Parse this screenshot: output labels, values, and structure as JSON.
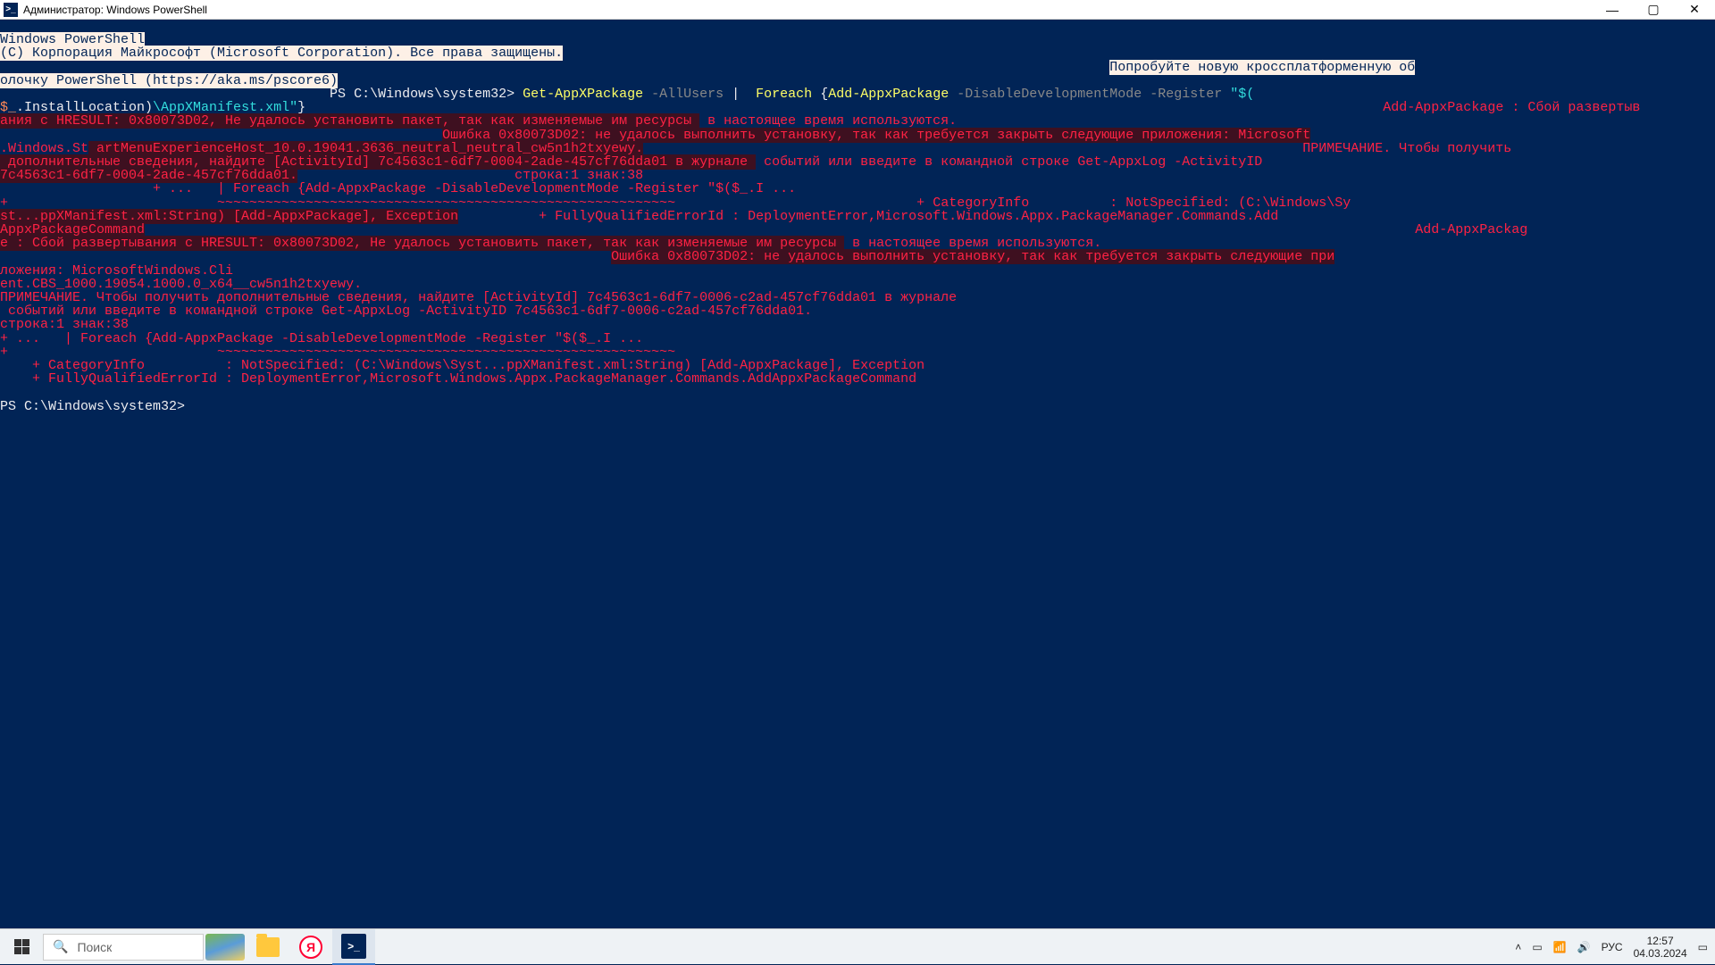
{
  "window": {
    "title": "Администратор: Windows PowerShell"
  },
  "terminal": {
    "l1": "Windows PowerShell",
    "l2": "(C) Корпорация Майкрософт (Microsoft Corporation). Все права защищены.",
    "l3": "Попробуйте новую кроссплатформенную об",
    "l4": "олочку PowerShell (https://aka.ms/pscore6)",
    "prompt1_pre": "                                         PS C:\\Windows\\system32> ",
    "cmd1_a": "Get-AppXPackage ",
    "cmd1_b": "-AllUsers ",
    "cmd1_c": "| ",
    "cmd1_d": " Foreach ",
    "cmd1_e": "{",
    "cmd1_f": "Add-AppxPackage ",
    "cmd1_g": "-DisableDevelopmentMode -Register ",
    "cmd1_h": "\"$(",
    "l5a": "$_",
    "l5b": ".InstallLocation)",
    "l5c": "\\AppXManifest.xml\"",
    "l5d": "}",
    "err_line_a": "Add-AppxPackage : Сбой развертыв",
    "err_hl_1": "ания с HRESULT: 0x80073D02, Не удалось установить пакет, так как изменяемые им ресурсы ",
    "err_1_tail": " в настоящее время используются.",
    "err_2_lead": "                                                       ",
    "err_hl_2": "Ошибка 0x80073D02: не удалось выполнить установку, так как требуется закрыть следующие приложения: Microsoft",
    "err_3a": ".Windows.St",
    "err_hl_3b": " artMenuExperienceHost_10.0.19041.3636_neutral_neutral_cw5n1h2txyewy.",
    "err_3c": "                                                                                  ПРИМЕЧАНИЕ. Чтобы получить",
    "err_hl_4": " дополнительные сведения, найдите [ActivityId] 7c4563c1-6df7-0004-2ade-457cf76dda01 в журнале ",
    "err_4b": " событий или введите в командной строке Get-AppxLog -ActivityID ",
    "err_hl_5": "7c4563c1-6df7-0004-2ade-457cf76dda01.",
    "err_5b": "                           строка:1 знак:38",
    "err_6a": "                   + ...   | Foreach {Add-AppxPackage -DisableDevelopmentMode -Register \"$($_.I ...",
    "err_7a": "+                          ",
    "err_tilde": "~~~~~~~~~~~~~~~~~~~~~~~~~~~~~~~~~~~~~~~~~~~~~~~~~~~~~~~~~",
    "err_7c": "                              + CategoryInfo          : NotSpecified: (C:\\Windows\\Sy",
    "err_hl_8a": "st...ppXManifest.xml:String) [Add-AppxPackage], Exception",
    "err_8b": "          + FullyQualifiedErrorId : DeploymentError,Microsoft.Windows.Appx.PackageManager.Commands.Add",
    "err_hl_9a": "AppxPackageCommand",
    "err_9b": "                                                                                                                                                              Add-AppxPackag",
    "err_hl_10": "e : Сбой развертывания с HRESULT: 0x80073D02, Не удалось установить пакет, так как изменяемые им ресурсы ",
    "err_10b": " в настоящее время используются.",
    "err_11a": "                                                                            ",
    "err_hl_11b": "Ошибка 0x80073D02: не удалось выполнить установку, так как требуется закрыть следующие при",
    "err_12": "ложения: MicrosoftWindows.Cli",
    "err_13": "ent.CBS_1000.19054.1000.0_x64__cw5n1h2txyewy.",
    "err_14": "ПРИМЕЧАНИЕ. Чтобы получить дополнительные сведения, найдите [ActivityId] 7c4563c1-6df7-0006-c2ad-457cf76dda01 в журнале",
    "err_15": " событий или введите в командной строке Get-AppxLog -ActivityID 7c4563c1-6df7-0006-c2ad-457cf76dda01.",
    "err_16": "строка:1 знак:38",
    "err_17": "+ ...   | Foreach {Add-AppxPackage -DisableDevelopmentMode -Register \"$($_.I ...",
    "err_18a": "+                          ",
    "err_18b": "~~~~~~~~~~~~~~~~~~~~~~~~~~~~~~~~~~~~~~~~~~~~~~~~~~~~~~~~~",
    "err_19": "    + CategoryInfo          : NotSpecified: (C:\\Windows\\Syst...ppXManifest.xml:String) [Add-AppxPackage], Exception",
    "err_20": "    + FullyQualifiedErrorId : DeploymentError,Microsoft.Windows.Appx.PackageManager.Commands.AddAppxPackageCommand",
    "prompt2": "PS C:\\Windows\\system32> "
  },
  "taskbar": {
    "search_placeholder": "Поиск",
    "lang": "РУС",
    "time": "12:57",
    "date": "04.03.2024"
  }
}
